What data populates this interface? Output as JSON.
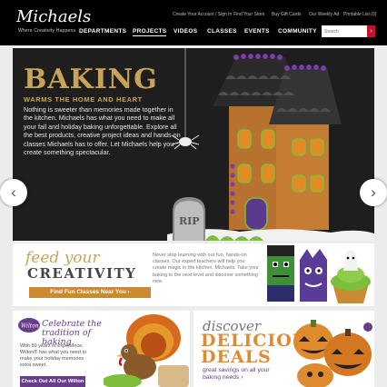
{
  "header": {
    "logo": "Michaels",
    "tagline": "Where Creativity Happens",
    "utility_links": [
      "Create Your Account / Sign In",
      "Find Your Store",
      "Buy Gift Cards",
      "Our Weekly Ad",
      "Printable List (0)"
    ],
    "nav": [
      "DEPARTMENTS",
      "PROJECTS",
      "VIDEOS",
      "CLASSES",
      "EVENTS",
      "COMMUNITY"
    ],
    "search_placeholder": "Search",
    "active_nav": "PROJECTS"
  },
  "hero": {
    "title": "BAKING",
    "subtitle": "WARMS THE HOME AND HEART",
    "body": "Nothing is sweeter than memories made together in the kitchen. Michaels has what you need to make all your fall and holiday baking unforgettable. Explore all the best products, creative project ideas and hands on classes Michaels has to offer. Let Michaels help you create something spectacular.",
    "prev_icon": "‹",
    "next_icon": "›",
    "rip_text": "RIP"
  },
  "classes_promo": {
    "script_title": "feed your",
    "title": "CREATIVITY",
    "button": "Find Fun Classes Near You ›",
    "body": "Never stop learning with our fun, hands-on classes. Our expert teachers will help you create magic in the kitchen. Michaels. Take your baking to the next level and discover something new."
  },
  "wilton_promo": {
    "logo": "Wilton",
    "title": "Celebrate the tradition of baking.",
    "body": "With 80 years of experience, Wilton® has what you need to make your holiday memories extra sweet.",
    "button": "Check Out All Our Wilton Products"
  },
  "deals_promo": {
    "script_title": "discover",
    "title": "DELICIOUS DEALS",
    "body": "great savings on all your baking needs ›"
  },
  "colors": {
    "accent": "#c4122f",
    "gold": "#c8a35a",
    "purple": "#6a3c8e",
    "orange": "#c98a32"
  }
}
